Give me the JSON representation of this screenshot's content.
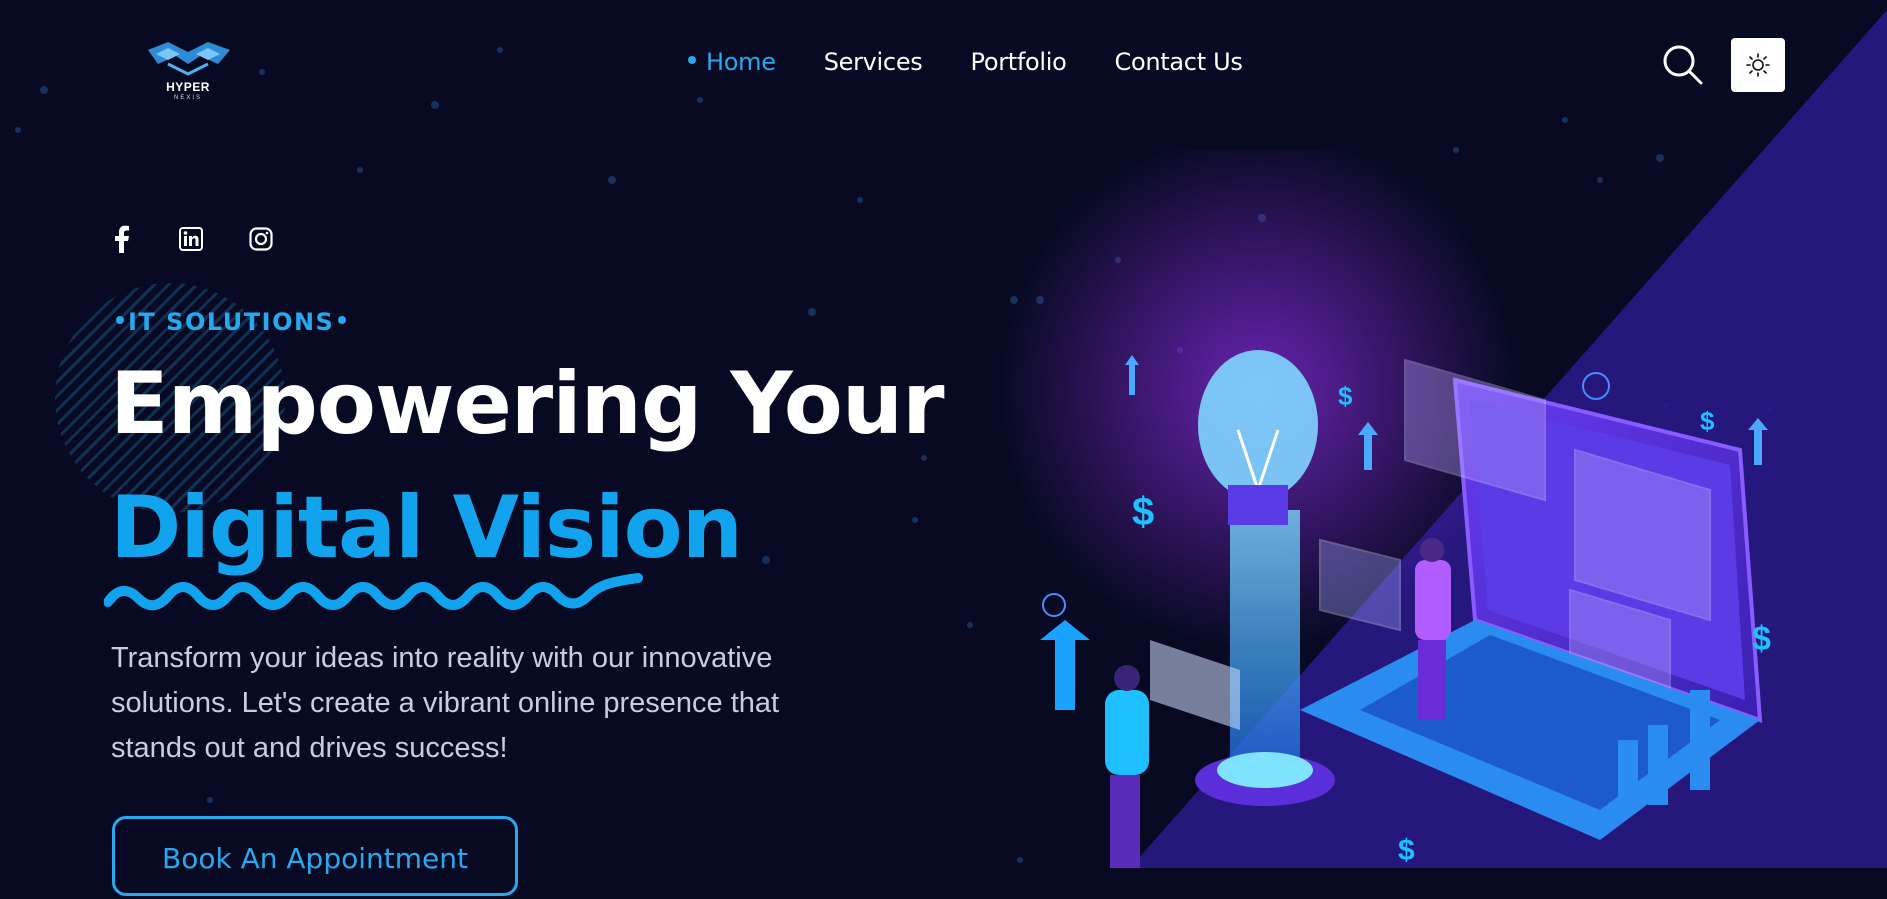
{
  "brand": {
    "name": "HYPER",
    "sub": "NEXIS"
  },
  "nav": {
    "items": [
      {
        "label": "Home",
        "active": true
      },
      {
        "label": "Services",
        "active": false
      },
      {
        "label": "Portfolio",
        "active": false
      },
      {
        "label": "Contact Us",
        "active": false
      }
    ]
  },
  "hero": {
    "tag": "IT SOLUTIONS",
    "title_line1": "Empowering Your",
    "title_line2": "Digital Vision",
    "description": "Transform your ideas into reality with our innovative solutions. Let's create a vibrant online presence that stands out and drives success!",
    "cta_label": "Book An Appointment"
  },
  "icons": {
    "social": [
      "facebook-icon",
      "linkedin-icon",
      "instagram-icon"
    ],
    "search": "search-icon",
    "theme": "sun-icon"
  },
  "colors": {
    "background": "#070a22",
    "accent": "#27a9ee",
    "purple": "#2a1a8c"
  }
}
